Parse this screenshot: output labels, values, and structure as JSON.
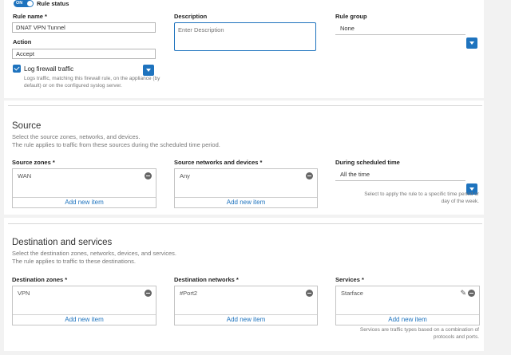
{
  "rule_status": {
    "toggle_label": "ON",
    "label": "Rule status"
  },
  "rule_name": {
    "label": "Rule name *",
    "value": "DNAT VPN Tunnel"
  },
  "description": {
    "label": "Description",
    "placeholder": "Enter Description"
  },
  "rule_group": {
    "label": "Rule group",
    "value": "None"
  },
  "action": {
    "label": "Action",
    "value": "Accept"
  },
  "log_traffic": {
    "label": "Log firewall traffic",
    "checked": true,
    "help_line1": "Logs traffic, matching this firewall rule, on the appliance (by",
    "help_line2": "default) or on the configured syslog server."
  },
  "source": {
    "title": "Source",
    "desc1": "Select the source zones, networks, and devices.",
    "desc2": "The rule applies to traffic from these sources during the scheduled time period.",
    "zones": {
      "label": "Source zones *",
      "item": "WAN",
      "add": "Add new item"
    },
    "networks": {
      "label": "Source networks and devices *",
      "item": "Any",
      "add": "Add new item"
    },
    "schedule": {
      "label": "During scheduled time",
      "value": "All the time",
      "help_line1": "Select to apply the rule to a specific time period or",
      "help_line2": "day of the week."
    }
  },
  "destination": {
    "title": "Destination and services",
    "desc1": "Select the destination zones, networks, devices, and services.",
    "desc2": "The rule applies to traffic to these destinations.",
    "zones": {
      "label": "Destination zones *",
      "item": "VPN",
      "add": "Add new item"
    },
    "networks": {
      "label": "Destination networks *",
      "item": "#Port2",
      "add": "Add new item"
    },
    "services": {
      "label": "Services *",
      "item": "Starface",
      "add": "Add new item",
      "help_line1": "Services are traffic types based on a combination of",
      "help_line2": "protocols and ports."
    }
  },
  "colors": {
    "accent": "#1e73be",
    "background": "#f2f2f2",
    "card": "#ffffff"
  }
}
